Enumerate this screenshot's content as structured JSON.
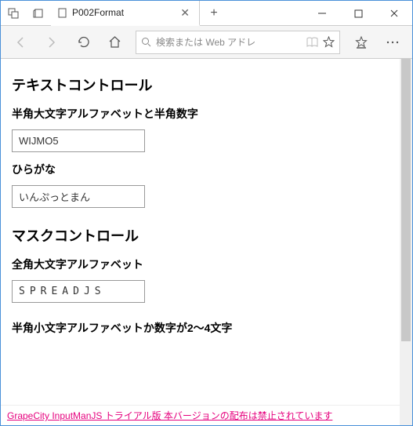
{
  "window": {
    "tab_title": "P002Format",
    "minimize": "—",
    "maximize": "☐",
    "close": "✕",
    "newtab": "+"
  },
  "toolbar": {
    "address_placeholder": "検索または Web アドレ"
  },
  "page": {
    "h_text_control": "テキストコントロール",
    "label_alpha_upper_num": "半角大文字アルファベットと半角数字",
    "value_alpha_upper_num": "WIJMO5",
    "label_hiragana": "ひらがな",
    "value_hiragana": "いんぷっとまん",
    "h_mask_control": "マスクコントロール",
    "label_fullwidth_upper": "全角大文字アルファベット",
    "value_fullwidth_upper": "SPREADJS",
    "label_lower_or_digit_2_4": "半角小文字アルファベットか数字が2～4文字",
    "footer_link": "GrapeCity InputManJS トライアル版 本バージョンの配布は禁止されています"
  }
}
